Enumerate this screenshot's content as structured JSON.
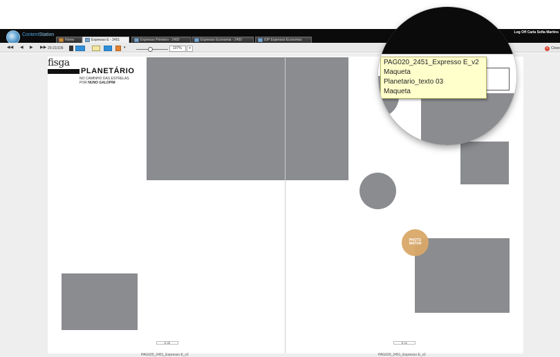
{
  "app": {
    "name_part1": "Content",
    "name_part2": "Station",
    "logoff": "Log Off Carla Sofia Martins"
  },
  "tabs": [
    {
      "label": "Home",
      "active": false
    },
    {
      "label": "Expresso E - 2451",
      "active": true
    },
    {
      "label": "Expresso Primeiro - 2450",
      "active": false
    },
    {
      "label": "Expresso Economia - 2450",
      "active": false
    },
    {
      "label": "IDP Expresso Economia",
      "active": false
    }
  ],
  "toolbar": {
    "first_icon": "◀◀",
    "prev_icon": "◀",
    "next_icon": "▶",
    "last_icon": "▶▶",
    "page_range": "20-21/106",
    "zoom": "107%",
    "zoom_dropdown": "▾",
    "close_label": "Close",
    "close_icon": "x"
  },
  "page": {
    "brand_logo": "fisga",
    "section_title": "PLANETÁRIO",
    "subtitle_line1": "NO CAMINHO DAS ESTRELAS",
    "subtitle_line2_prefix": "POR ",
    "subtitle_line2_author": "NUNO GALOPIM",
    "left_page_number": "E 20",
    "right_page_number": "E 21",
    "left_page_name": "PAG020_2451_Expresso E_v2",
    "right_page_name": "PAG020_2451_Expresso E_v2",
    "photo_badge_line1": "PHOTO",
    "photo_badge_line2": "MATON"
  },
  "tooltip": {
    "line1": "PAG020_2451_Expresso E_v2",
    "line2": "Maqueta",
    "line3": "Planetario_texto 03",
    "line4": "Maqueta"
  },
  "colors": {
    "topbar": "#0b0b0b",
    "placeholder_grey": "#8a8c8f",
    "tooltip_bg": "#ffffcc",
    "photo_badge": "#d8a868",
    "accent_blue": "#4aa3df"
  }
}
